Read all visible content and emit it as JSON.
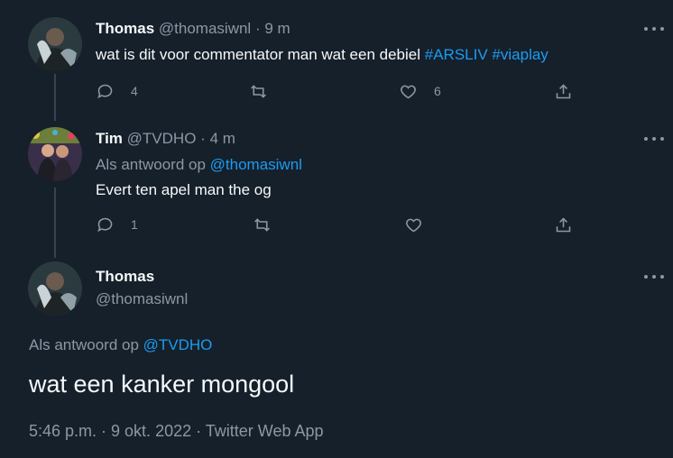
{
  "tweets": [
    {
      "name": "Thomas",
      "handle": "@thomasiwnl",
      "sep": "·",
      "time": "9 m",
      "text": "wat is dit voor commentator man wat een debiel",
      "hashtags": [
        "#ARSLIV",
        "#viaplay"
      ],
      "reply_count": "4",
      "retweet_count": "",
      "like_count": "6"
    },
    {
      "name": "Tim",
      "handle": "@TVDHO",
      "sep": "·",
      "time": "4 m",
      "reply_prefix": "Als antwoord op",
      "reply_to": "@thomasiwnl",
      "text": "Evert ten apel man the og",
      "reply_count": "1",
      "retweet_count": "",
      "like_count": ""
    }
  ],
  "main_tweet": {
    "name": "Thomas",
    "handle": "@thomasiwnl",
    "reply_prefix": "Als antwoord op",
    "reply_to": "@TVDHO",
    "text": "wat een kanker mongool",
    "meta": "5:46 p.m. · 9 okt. 2022 · Twitter Web App"
  },
  "icons": {
    "more": "more-icon",
    "reply": "reply-icon",
    "retweet": "retweet-icon",
    "like": "like-icon",
    "share": "share-icon"
  },
  "colors": {
    "background": "#15202b",
    "text": "#f7f9f9",
    "muted": "#8b98a5",
    "link": "#1d9bf0",
    "thread_line": "#38444d"
  }
}
